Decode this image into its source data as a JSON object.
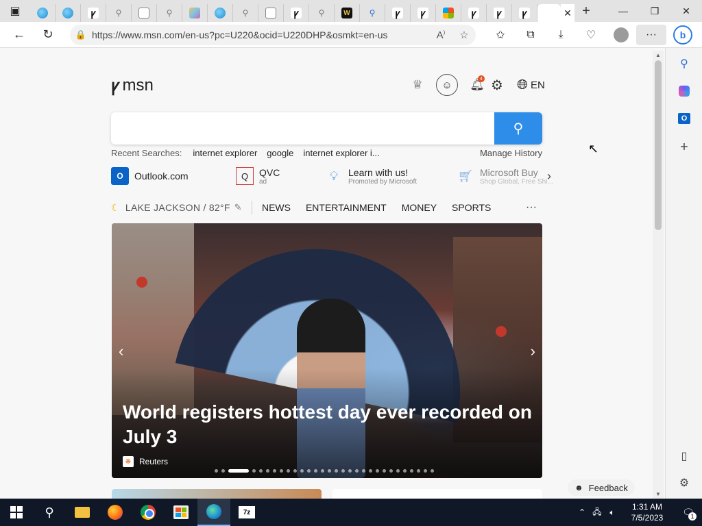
{
  "browser": {
    "url": "https://www.msn.com/en-us?pc=U220&ocid=U220DHP&osmkt=en-us",
    "active_tab_label": "",
    "new_tab_glyph": "+",
    "more_glyph": "···",
    "bing_label": "b"
  },
  "msn": {
    "logo_text": "msn",
    "bell_badge": "4",
    "language": "EN"
  },
  "search": {
    "placeholder": "",
    "recent_label": "Recent Searches:",
    "recent_items": [
      "internet explorer",
      "google",
      "internet explorer i..."
    ],
    "manage_history": "Manage History"
  },
  "quick_links": {
    "outlook": {
      "name": "Outlook.com"
    },
    "qvc": {
      "name": "QVC",
      "sub": "ad"
    },
    "learn": {
      "name": "Learn with us!",
      "sub": "Promoted by Microsoft"
    },
    "buy": {
      "name": "Microsoft Buy",
      "sub": "Shop Global, Free Shi..."
    }
  },
  "nav": {
    "weather": "LAKE JACKSON / 82°F",
    "items": [
      "NEWS",
      "ENTERTAINMENT",
      "MONEY",
      "SPORTS"
    ],
    "more": "···"
  },
  "hero": {
    "headline": "World registers hottest day ever recorded on July 3",
    "source": "Reuters",
    "slide_count": 30,
    "active_slide": 2
  },
  "feedback": {
    "label": "Feedback"
  },
  "taskbar": {
    "time": "1:31 AM",
    "date": "7/5/2023",
    "notification_count": "1",
    "sevenzip_label": "7z"
  },
  "colors": {
    "accent": "#2e8de8",
    "taskbar": "#101828",
    "badge": "#e74f1c"
  }
}
